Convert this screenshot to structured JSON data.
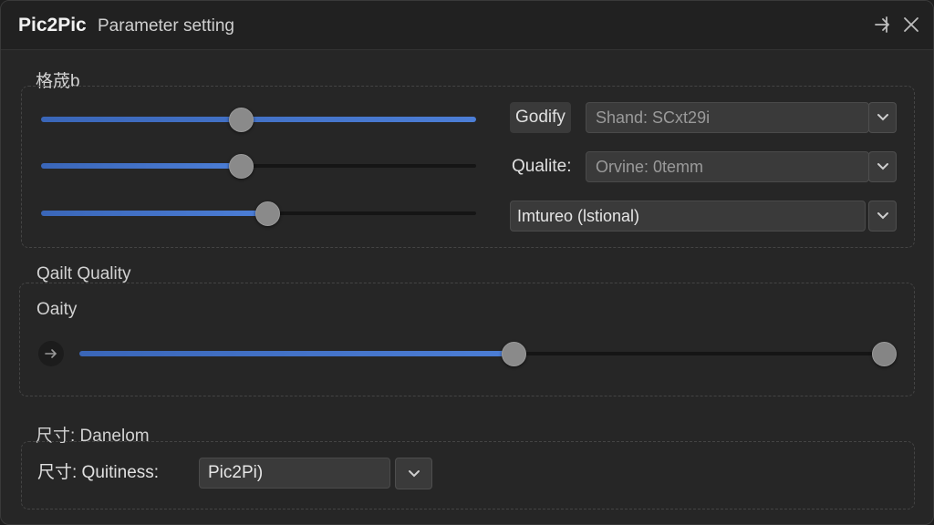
{
  "window": {
    "app_name": "Pic2Pic",
    "subtitle": "Parameter setting",
    "icons": {
      "pin": "pin-arrow-icon",
      "close": "close-icon"
    }
  },
  "format_group": {
    "title": "格荿b",
    "sliders": [
      {
        "value": 0.46
      },
      {
        "value": 0.46
      },
      {
        "value": 0.52
      }
    ],
    "rows": [
      {
        "label": "Godify",
        "value": "Shand: SCxt29i"
      },
      {
        "label": "Qualite:",
        "value": "Orvine: 0temm"
      },
      {
        "label": "Imtureo (lstional)",
        "value": ""
      }
    ]
  },
  "quality_group": {
    "header": "Qailt Quality",
    "title": "Oaity",
    "slider": {
      "value": 0.54
    }
  },
  "size_group": {
    "header": "尺寸: Danelom",
    "label": "尺寸: Quitiness:",
    "value": "Pic2Pi)"
  },
  "colors": {
    "accent": "#4c7ed6",
    "background": "#262626",
    "control": "#3a3a3a"
  }
}
